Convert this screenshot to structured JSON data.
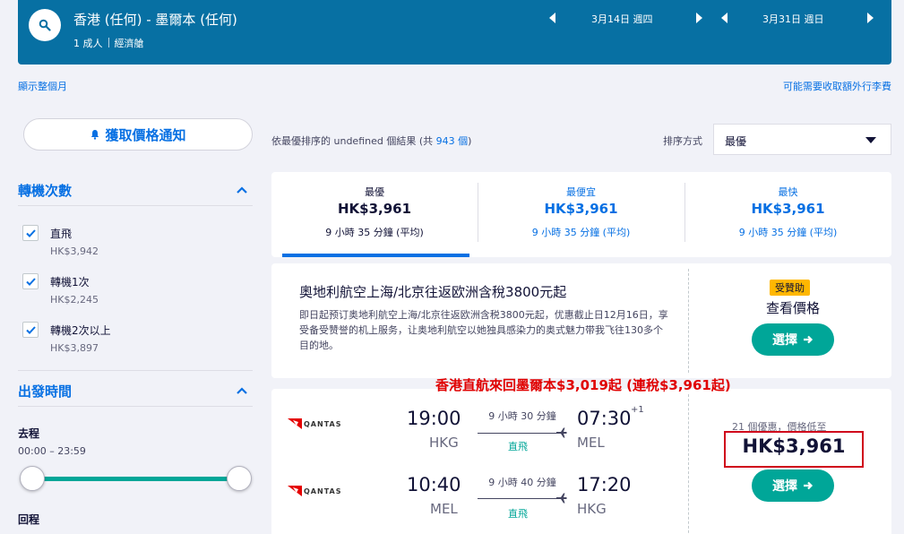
{
  "header": {
    "route": "香港 (任何) - 墨爾本 (任何)",
    "passengers": "1 成人",
    "cabin": "經濟艙",
    "depart_date": "3月14日 週四",
    "return_date": "3月31日 週日"
  },
  "links": {
    "show_month": "顯示整個月",
    "baggage_fees": "可能需要收取額外行李費"
  },
  "sidebar": {
    "price_alert": "獲取價格通知",
    "stops": {
      "title": "轉機次數",
      "options": [
        {
          "label": "直飛",
          "price": "HK$3,942"
        },
        {
          "label": "轉機1次",
          "price": "HK$2,245"
        },
        {
          "label": "轉機2次以上",
          "price": "HK$3,897"
        }
      ]
    },
    "times": {
      "title": "出發時間",
      "outbound": "去程",
      "outbound_range": "00:00 – 23:59",
      "return": "回程"
    }
  },
  "results": {
    "info_prefix": "依最優排序的 undefined 個結果 (共",
    "count": "943 個",
    "info_suffix": ")",
    "sort_label": "排序方式",
    "sort_value": "最優"
  },
  "tabs": [
    {
      "label": "最優",
      "price": "HK$3,961",
      "duration": "9 小時 35 分鐘 (平均)"
    },
    {
      "label": "最便宜",
      "price": "HK$3,961",
      "duration": "9 小時 35 分鐘 (平均)"
    },
    {
      "label": "最快",
      "price": "HK$3,961",
      "duration": "9 小時 35 分鐘 (平均)"
    }
  ],
  "ad": {
    "title": "奧地利航空上海/北京往返欧洲含稅3800元起",
    "description": "即日起预订奥地利航空上海/北京往返欧洲含税3800元起，优惠截止日12月16日，享受备受赞誉的机上服务，让奥地利航空以她独具感染力的奥式魅力带我飞往130多个目的地。",
    "sponsored": "受贊助",
    "view_price": "查看價格",
    "select": "選擇"
  },
  "promo": "香港直航來回墨爾本$3,019起 (連稅$3,961起)",
  "flight": {
    "airline": "QANTAS",
    "outbound": {
      "dep_time": "19:00",
      "dep_code": "HKG",
      "duration": "9 小時 30 分鐘",
      "stops": "直飛",
      "arr_time": "07:30",
      "arr_code": "MEL",
      "day_offset": "+1"
    },
    "inbound": {
      "dep_time": "10:40",
      "dep_code": "MEL",
      "duration": "9 小時 40 分鐘",
      "stops": "直飛",
      "arr_time": "17:20",
      "arr_code": "HKG"
    },
    "deals": "21 個優惠，價格低至",
    "price": "HK$3,961",
    "select": "選擇"
  },
  "colors": {
    "brand": "#0770a3",
    "link": "#0770e3",
    "accent": "#00a698",
    "highlight": "#e00000"
  }
}
